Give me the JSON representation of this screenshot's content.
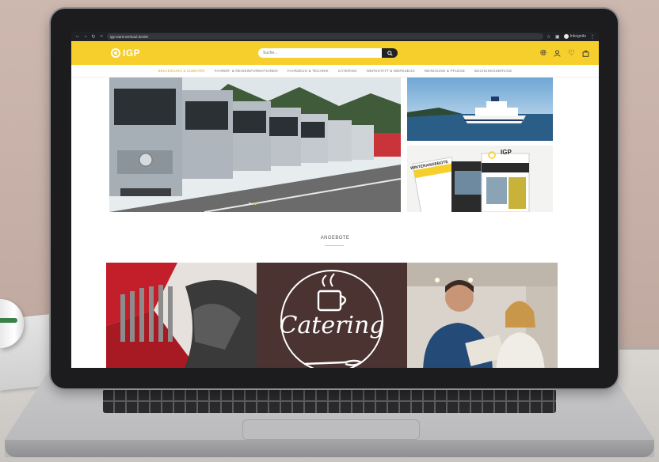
{
  "browser": {
    "url": "igp-warenverkauf.de/de/",
    "profile_name": "Inkognito"
  },
  "site": {
    "logo_text": "IGP",
    "search_placeholder": "Suche...",
    "brand_color": "#f6cf2c",
    "header_icons": [
      "globe-icon",
      "user-icon",
      "heart-icon",
      "bag-icon"
    ],
    "nav": [
      "Bekleidung & Zubehör",
      "Fahrer- & Reiseinformationen",
      "Fahrzeug & Technik",
      "Catering",
      "Werkstatt & Werkzeug",
      "Reinigung & Pflege",
      "Buchungsservice"
    ],
    "active_nav_index": 0
  },
  "hero": {
    "slide_count": 2,
    "active_slide": 2,
    "catalog_logo": "IGP",
    "catalog_title": "WINTERANGEBOTE"
  },
  "offers_section": {
    "title": "ANGEBOTE",
    "tiles": [
      {
        "name": "tools"
      },
      {
        "name": "catering",
        "label": "Catering"
      },
      {
        "name": "business"
      }
    ]
  }
}
